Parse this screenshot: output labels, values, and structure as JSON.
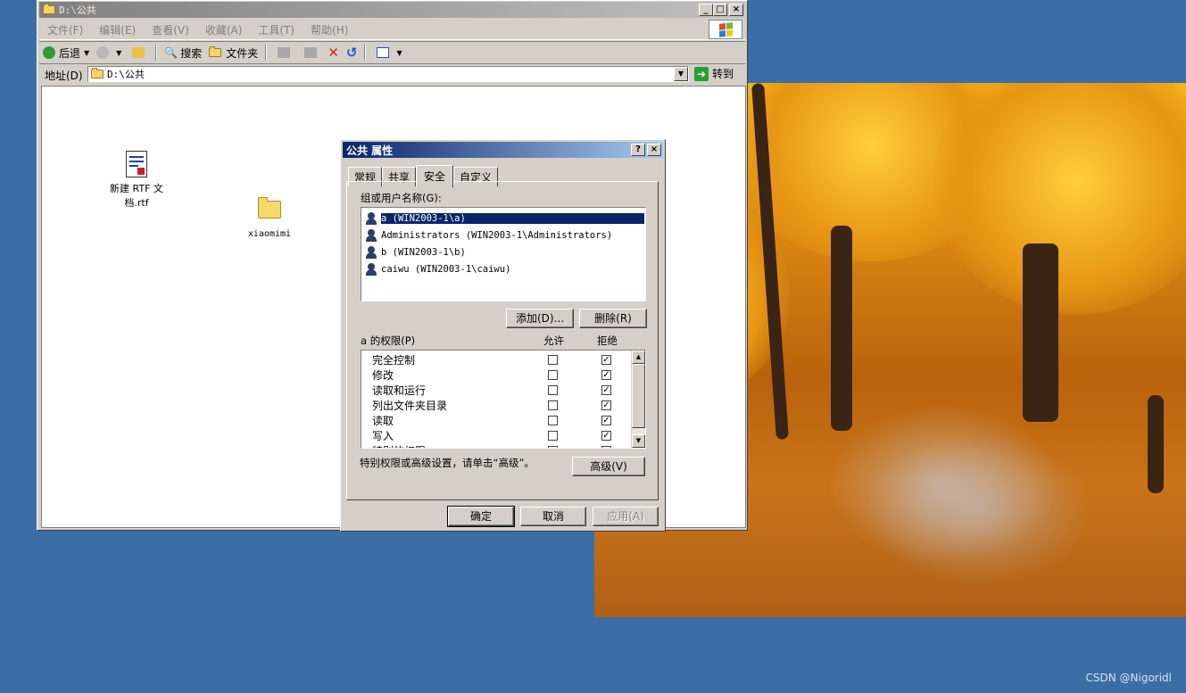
{
  "desktop": {
    "watermark": "CSDN @Nigoridl"
  },
  "explorer": {
    "title": "D:\\公共",
    "menu": [
      "文件(F)",
      "编辑(E)",
      "查看(V)",
      "收藏(A)",
      "工具(T)",
      "帮助(H)"
    ],
    "toolbar": {
      "back": "后退",
      "search": "搜索",
      "folders": "文件夹"
    },
    "address": {
      "label": "地址(D)",
      "value": "D:\\公共",
      "go": "转到"
    },
    "items": [
      {
        "name": "新建 RTF 文档.rtf",
        "line1": "新建 RTF 文",
        "line2": "档.rtf",
        "icon": "rtf-document-icon"
      },
      {
        "name": "xiaomimi",
        "icon": "folder-icon"
      }
    ]
  },
  "dialog": {
    "title": "公共 属性",
    "help": "?",
    "close": "×",
    "tabs": [
      "常规",
      "共享",
      "安全",
      "自定义"
    ],
    "selected_tab": "安全",
    "users_label": "组或用户名称(G):",
    "users": [
      "a (WIN2003-1\\a)",
      "Administrators (WIN2003-1\\Administrators)",
      "b (WIN2003-1\\b)",
      "caiwu (WIN2003-1\\caiwu)"
    ],
    "add_button": "添加(D)...",
    "remove_button": "删除(R)",
    "perms_label": "a 的权限(P)",
    "allow_header": "允许",
    "deny_header": "拒绝",
    "permissions": [
      {
        "name": "完全控制",
        "allow": false,
        "deny": true
      },
      {
        "name": "修改",
        "allow": false,
        "deny": true
      },
      {
        "name": "读取和运行",
        "allow": false,
        "deny": true
      },
      {
        "name": "列出文件夹目录",
        "allow": false,
        "deny": true
      },
      {
        "name": "读取",
        "allow": false,
        "deny": true
      },
      {
        "name": "写入",
        "allow": false,
        "deny": true
      },
      {
        "name": "特别的权限",
        "allow": false,
        "deny": false
      }
    ],
    "advanced_hint": "特别权限或高级设置，请单击“高级”。",
    "advanced_button": "高级(V)",
    "ok_button": "确定",
    "cancel_button": "取消",
    "apply_button": "应用(A)"
  }
}
